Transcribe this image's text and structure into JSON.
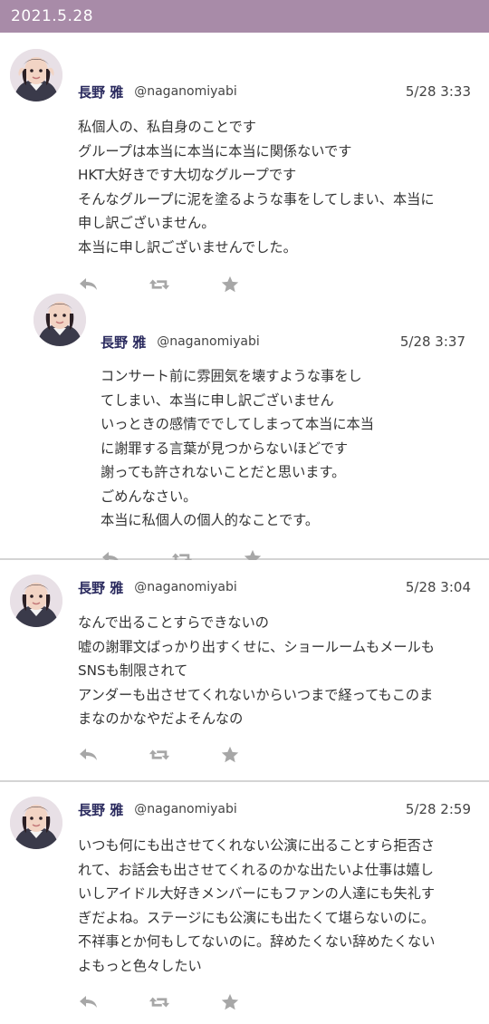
{
  "header": {
    "date": "2021.5.28"
  },
  "colors": {
    "header_bg": "#a88ba8",
    "name": "#2a2a5e",
    "icon": "#a7a7a7",
    "divider": "#d4d4d4"
  },
  "tweets": [
    {
      "name": "長野 雅",
      "handle": "@naganomiyabi",
      "time": "5/28 3:33",
      "lines": [
        "私個人の、私自身のことです",
        "グループは本当に本当に本当に関係ないです",
        "HKT大好きです大切なグループです",
        "そんなグループに泥を塗るような事をしてしまい、本当に",
        "申し訳ございません。",
        "本当に申し訳ございませんでした。"
      ],
      "actions": [
        "reply-icon",
        "retweet-icon",
        "favorite-icon"
      ]
    },
    {
      "name": "長野 雅",
      "handle": "@naganomiyabi",
      "time": "5/28 3:37",
      "lines": [
        "コンサート前に雰囲気を壊すような事をし",
        "てしまい、本当に申し訳ございません",
        "いっときの感情ででしてしまって本当に本当",
        "に謝罪する言葉が見つからないほどです",
        "謝っても許されないことだと思います。",
        "ごめんなさい。",
        "本当に私個人の個人的なことです。"
      ],
      "actions": [
        "reply-icon",
        "retweet-icon",
        "favorite-icon"
      ]
    },
    {
      "name": "長野 雅",
      "handle": "@naganomiyabi",
      "time": "5/28 3:04",
      "lines": [
        "なんで出ることすらできないの",
        "嘘の謝罪文ばっかり出すくせに、ショールームもメールも",
        "SNSも制限されて",
        "アンダーも出させてくれないからいつまで経ってもこのま",
        "まなのかなやだよそんなの"
      ],
      "actions": [
        "reply-icon",
        "retweet-icon",
        "favorite-icon"
      ]
    },
    {
      "name": "長野 雅",
      "handle": "@naganomiyabi",
      "time": "5/28 2:59",
      "lines": [
        "いつも何にも出させてくれない公演に出ることすら拒否さ",
        "れて、お話会も出させてくれるのかな出たいよ仕事は嬉し",
        "いしアイドル大好きメンバーにもファンの人達にも失礼す",
        "ぎだよね。ステージにも公演にも出たくて堪らないのに。",
        "不祥事とか何もしてないのに。辞めたくない辞めたくない",
        "よもっと色々したい"
      ],
      "actions": [
        "reply-icon",
        "retweet-icon",
        "favorite-icon"
      ]
    }
  ]
}
